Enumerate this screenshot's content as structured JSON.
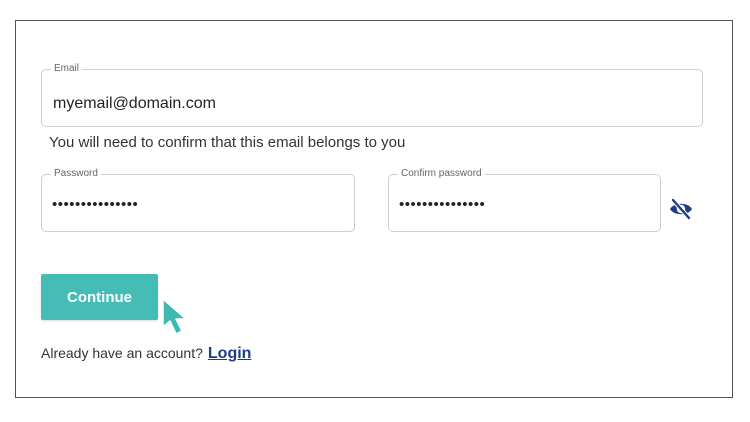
{
  "form": {
    "email_label": "Email",
    "email_value": "myemail@domain.com",
    "helper_text": "You will need to confirm that this email belongs to you",
    "password_label": "Password",
    "password_value": "•••••••••••••••",
    "confirm_label": "Confirm password",
    "confirm_value": "•••••••••••••••",
    "visibility_icon": "eye-slash-icon",
    "continue_label": "Continue",
    "account_prompt": "Already have an account?",
    "login_label": "Login"
  },
  "colors": {
    "button": "#45bcb5",
    "cursor": "#3fb8b0",
    "link": "#1f3c88",
    "icon": "#1f3c88"
  }
}
